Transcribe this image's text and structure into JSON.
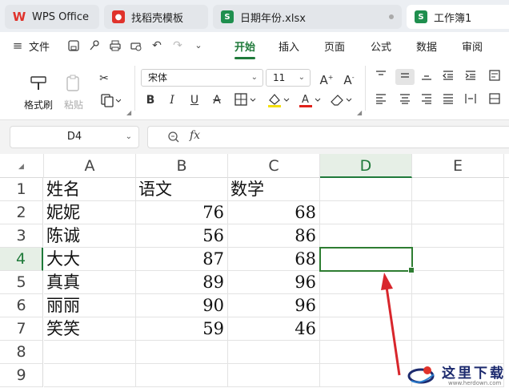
{
  "tabs": [
    {
      "label": "WPS Office",
      "icon": "wps-logo-icon",
      "color": "#e0322b"
    },
    {
      "label": "找稻壳模板",
      "icon": "docer-icon",
      "color": "#e0322b"
    },
    {
      "label": "日期年份.xlsx",
      "icon": "sheet-s-icon",
      "color": "#1f8f4e"
    },
    {
      "label": "工作簿1",
      "icon": "sheet-s-icon",
      "color": "#1f8f4e"
    }
  ],
  "menu": {
    "file": "文件",
    "items": [
      "开始",
      "插入",
      "页面",
      "公式",
      "数据",
      "审阅"
    ],
    "active": "开始"
  },
  "ribbon": {
    "format_painter": "格式刷",
    "paste": "粘贴",
    "font_name": "宋体",
    "font_size": "11"
  },
  "formula_bar": {
    "name_box": "D4",
    "fx_label": "fx",
    "value": ""
  },
  "sheet": {
    "columns": [
      "A",
      "B",
      "C",
      "D",
      "E"
    ],
    "rows": [
      "1",
      "2",
      "3",
      "4",
      "5",
      "6",
      "7",
      "8",
      "9"
    ],
    "active_cell": "D4",
    "header": [
      "姓名",
      "语文",
      "数学"
    ],
    "data": [
      [
        "妮妮",
        "76",
        "68"
      ],
      [
        "陈诚",
        "56",
        "86"
      ],
      [
        "大大",
        "87",
        "68"
      ],
      [
        "真真",
        "89",
        "96"
      ],
      [
        "丽丽",
        "90",
        "96"
      ],
      [
        "笑笑",
        "59",
        "46"
      ]
    ]
  },
  "watermark": {
    "text": "这里下载",
    "url": "www.herdown.com"
  },
  "colors": {
    "accent": "#1f7a3a",
    "annotation_arrow": "#d8262c"
  }
}
